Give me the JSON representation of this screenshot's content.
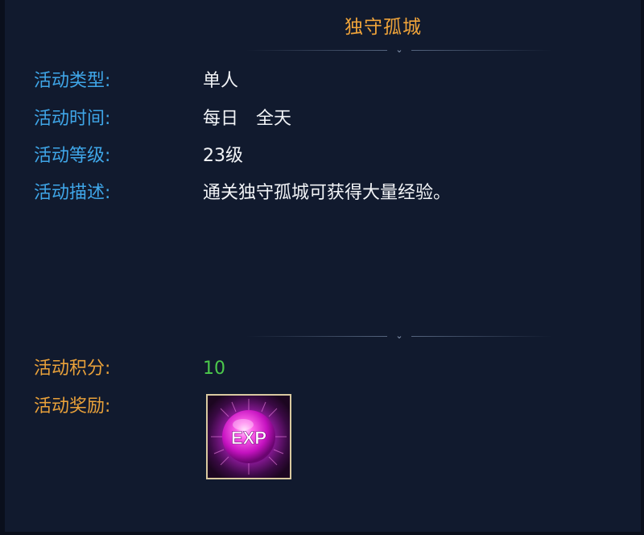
{
  "title": "独守孤城",
  "info": {
    "type_label": "活动类型:",
    "type_value": "单人",
    "time_label": "活动时间:",
    "time_day": "每日",
    "time_range": "全天",
    "level_label": "活动等级:",
    "level_value": "23级",
    "desc_label": "活动描述:",
    "desc_value": "通关独守孤城可获得大量经验。"
  },
  "rewards": {
    "points_label": "活动积分:",
    "points_value": "10",
    "reward_label": "活动奖励:",
    "reward_item_icon": "exp-orb-icon",
    "reward_item_text": "EXP"
  },
  "colors": {
    "label_blue": "#3fa6e8",
    "label_gold": "#e9a13a",
    "title": "#f0a43a",
    "points_green": "#4cc94c"
  }
}
